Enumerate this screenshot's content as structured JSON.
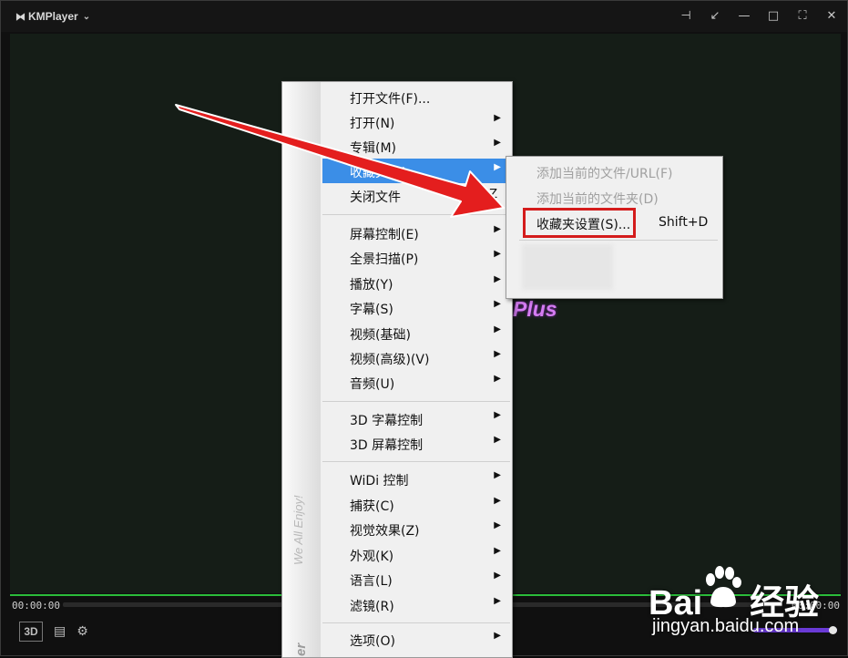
{
  "app": {
    "title": "KMPlayer"
  },
  "player": {
    "time_left": "00:00:00",
    "time_right": "00:00:00",
    "btn_3d": "3D",
    "overlay_text": "Plus"
  },
  "menu": {
    "strip_text": "We All Enjoy!",
    "strip_text_2": "er",
    "items": [
      {
        "label": "打开文件(F)..."
      },
      {
        "label": "打开(N)"
      },
      {
        "label": "专辑(M)"
      },
      {
        "label": "收藏夹(A)"
      },
      {
        "label": "关闭文件",
        "shortcut": "Z"
      },
      {
        "label": "屏幕控制(E)"
      },
      {
        "label": "全景扫描(P)"
      },
      {
        "label": "播放(Y)"
      },
      {
        "label": "字幕(S)"
      },
      {
        "label": "视频(基础)"
      },
      {
        "label": "视频(高级)(V)"
      },
      {
        "label": "音频(U)"
      },
      {
        "label": "3D 字幕控制"
      },
      {
        "label": "3D 屏幕控制"
      },
      {
        "label": "WiDi 控制"
      },
      {
        "label": "捕获(C)"
      },
      {
        "label": "视觉效果(Z)"
      },
      {
        "label": "外观(K)"
      },
      {
        "label": "语言(L)"
      },
      {
        "label": "滤镜(R)"
      },
      {
        "label": "选项(O)"
      }
    ]
  },
  "submenu": {
    "items": [
      {
        "label": "添加当前的文件/URL(F)"
      },
      {
        "label": "添加当前的文件夹(D)"
      },
      {
        "label": "收藏夹设置(S)...",
        "shortcut": "Shift+D"
      }
    ]
  },
  "watermark": {
    "main": "Bai",
    "main_end": "经验",
    "sub": "jingyan.baidu.com"
  },
  "colors": {
    "highlight": "#3b8ee7",
    "annotation_red": "#d41c1c",
    "progress_green": "#2bbd3a"
  }
}
